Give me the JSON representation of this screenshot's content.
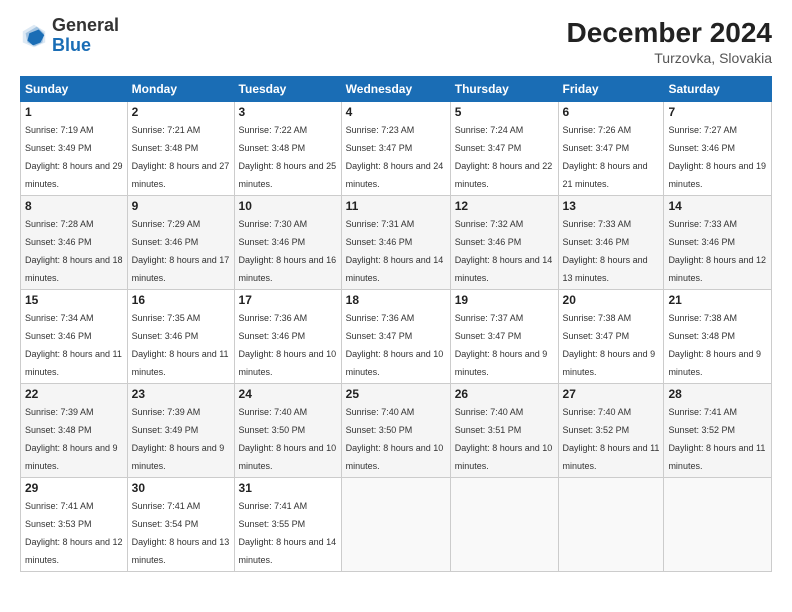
{
  "header": {
    "logo_general": "General",
    "logo_blue": "Blue",
    "month_year": "December 2024",
    "location": "Turzovka, Slovakia"
  },
  "weekdays": [
    "Sunday",
    "Monday",
    "Tuesday",
    "Wednesday",
    "Thursday",
    "Friday",
    "Saturday"
  ],
  "weeks": [
    [
      {
        "day": "1",
        "sunrise": "7:19 AM",
        "sunset": "3:49 PM",
        "daylight": "8 hours and 29 minutes."
      },
      {
        "day": "2",
        "sunrise": "7:21 AM",
        "sunset": "3:48 PM",
        "daylight": "8 hours and 27 minutes."
      },
      {
        "day": "3",
        "sunrise": "7:22 AM",
        "sunset": "3:48 PM",
        "daylight": "8 hours and 25 minutes."
      },
      {
        "day": "4",
        "sunrise": "7:23 AM",
        "sunset": "3:47 PM",
        "daylight": "8 hours and 24 minutes."
      },
      {
        "day": "5",
        "sunrise": "7:24 AM",
        "sunset": "3:47 PM",
        "daylight": "8 hours and 22 minutes."
      },
      {
        "day": "6",
        "sunrise": "7:26 AM",
        "sunset": "3:47 PM",
        "daylight": "8 hours and 21 minutes."
      },
      {
        "day": "7",
        "sunrise": "7:27 AM",
        "sunset": "3:46 PM",
        "daylight": "8 hours and 19 minutes."
      }
    ],
    [
      {
        "day": "8",
        "sunrise": "7:28 AM",
        "sunset": "3:46 PM",
        "daylight": "8 hours and 18 minutes."
      },
      {
        "day": "9",
        "sunrise": "7:29 AM",
        "sunset": "3:46 PM",
        "daylight": "8 hours and 17 minutes."
      },
      {
        "day": "10",
        "sunrise": "7:30 AM",
        "sunset": "3:46 PM",
        "daylight": "8 hours and 16 minutes."
      },
      {
        "day": "11",
        "sunrise": "7:31 AM",
        "sunset": "3:46 PM",
        "daylight": "8 hours and 14 minutes."
      },
      {
        "day": "12",
        "sunrise": "7:32 AM",
        "sunset": "3:46 PM",
        "daylight": "8 hours and 14 minutes."
      },
      {
        "day": "13",
        "sunrise": "7:33 AM",
        "sunset": "3:46 PM",
        "daylight": "8 hours and 13 minutes."
      },
      {
        "day": "14",
        "sunrise": "7:33 AM",
        "sunset": "3:46 PM",
        "daylight": "8 hours and 12 minutes."
      }
    ],
    [
      {
        "day": "15",
        "sunrise": "7:34 AM",
        "sunset": "3:46 PM",
        "daylight": "8 hours and 11 minutes."
      },
      {
        "day": "16",
        "sunrise": "7:35 AM",
        "sunset": "3:46 PM",
        "daylight": "8 hours and 11 minutes."
      },
      {
        "day": "17",
        "sunrise": "7:36 AM",
        "sunset": "3:46 PM",
        "daylight": "8 hours and 10 minutes."
      },
      {
        "day": "18",
        "sunrise": "7:36 AM",
        "sunset": "3:47 PM",
        "daylight": "8 hours and 10 minutes."
      },
      {
        "day": "19",
        "sunrise": "7:37 AM",
        "sunset": "3:47 PM",
        "daylight": "8 hours and 9 minutes."
      },
      {
        "day": "20",
        "sunrise": "7:38 AM",
        "sunset": "3:47 PM",
        "daylight": "8 hours and 9 minutes."
      },
      {
        "day": "21",
        "sunrise": "7:38 AM",
        "sunset": "3:48 PM",
        "daylight": "8 hours and 9 minutes."
      }
    ],
    [
      {
        "day": "22",
        "sunrise": "7:39 AM",
        "sunset": "3:48 PM",
        "daylight": "8 hours and 9 minutes."
      },
      {
        "day": "23",
        "sunrise": "7:39 AM",
        "sunset": "3:49 PM",
        "daylight": "8 hours and 9 minutes."
      },
      {
        "day": "24",
        "sunrise": "7:40 AM",
        "sunset": "3:50 PM",
        "daylight": "8 hours and 10 minutes."
      },
      {
        "day": "25",
        "sunrise": "7:40 AM",
        "sunset": "3:50 PM",
        "daylight": "8 hours and 10 minutes."
      },
      {
        "day": "26",
        "sunrise": "7:40 AM",
        "sunset": "3:51 PM",
        "daylight": "8 hours and 10 minutes."
      },
      {
        "day": "27",
        "sunrise": "7:40 AM",
        "sunset": "3:52 PM",
        "daylight": "8 hours and 11 minutes."
      },
      {
        "day": "28",
        "sunrise": "7:41 AM",
        "sunset": "3:52 PM",
        "daylight": "8 hours and 11 minutes."
      }
    ],
    [
      {
        "day": "29",
        "sunrise": "7:41 AM",
        "sunset": "3:53 PM",
        "daylight": "8 hours and 12 minutes."
      },
      {
        "day": "30",
        "sunrise": "7:41 AM",
        "sunset": "3:54 PM",
        "daylight": "8 hours and 13 minutes."
      },
      {
        "day": "31",
        "sunrise": "7:41 AM",
        "sunset": "3:55 PM",
        "daylight": "8 hours and 14 minutes."
      },
      null,
      null,
      null,
      null
    ]
  ]
}
